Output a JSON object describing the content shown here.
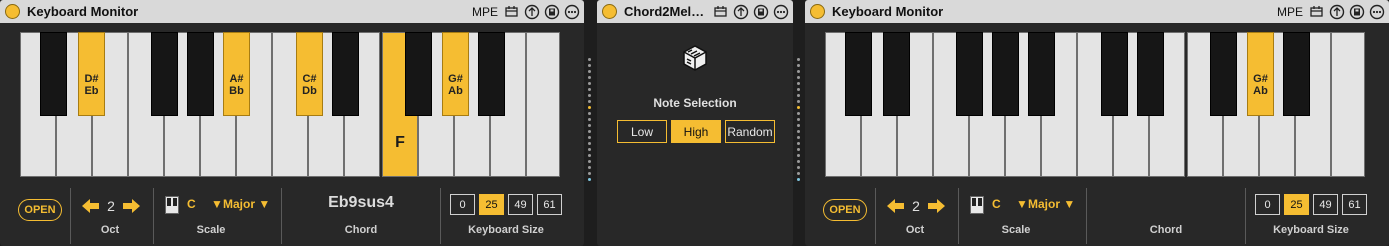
{
  "devices": {
    "left": {
      "title": "Keyboard Monitor",
      "mpe_label": "MPE",
      "open_label": "OPEN",
      "octave": "2",
      "scale_root": "C",
      "scale_mode": "Major",
      "chord": "Eb9sus4",
      "oct_label": "Oct",
      "scale_label": "Scale",
      "chord_label": "Chord",
      "ksize_label": "Keyboard Size",
      "keyboard_sizes": [
        "0",
        "25",
        "49",
        "61"
      ],
      "selected_size": "25",
      "key_labels": {
        "ds": "D#\nEb",
        "as": "A#\nBb",
        "cs": "C#\nDb",
        "gs": "G#\nAb",
        "f": "F"
      }
    },
    "middle": {
      "title": "Chord2Mel…",
      "section_title": "Note Selection",
      "options": [
        "Low",
        "High",
        "Random"
      ],
      "selected_option": "High"
    },
    "right": {
      "title": "Keyboard Monitor",
      "mpe_label": "MPE",
      "open_label": "OPEN",
      "octave": "2",
      "scale_root": "C",
      "scale_mode": "Major",
      "chord": "",
      "oct_label": "Oct",
      "scale_label": "Scale",
      "chord_label": "Chord",
      "ksize_label": "Keyboard Size",
      "keyboard_sizes": [
        "0",
        "25",
        "49",
        "61"
      ],
      "selected_size": "25",
      "key_labels": {
        "gs": "G#\nAb"
      }
    }
  },
  "colors": {
    "accent": "#f5bd32",
    "panel": "#282828",
    "titlebar": "#d9d9d9"
  },
  "icons": [
    "power-icon",
    "midi-map-icon",
    "hotswap-icon",
    "save-icon",
    "more-icon",
    "scale-icon",
    "arrow-left-icon",
    "arrow-right-icon",
    "device-logo-icon"
  ]
}
